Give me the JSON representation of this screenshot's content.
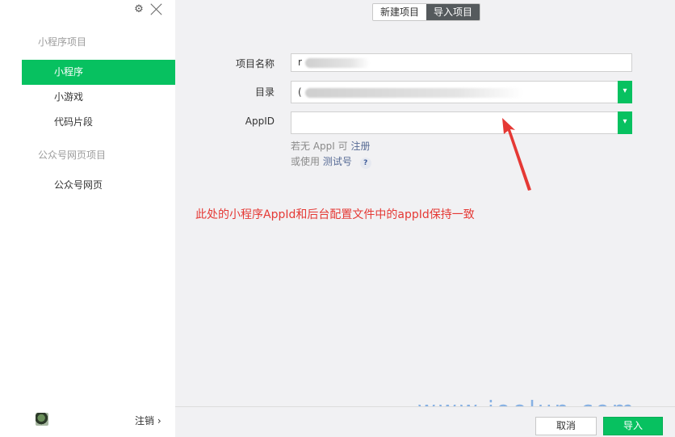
{
  "sidebar": {
    "section_miniprogram": "小程序项目",
    "items_miniprogram": [
      {
        "label": "小程序"
      },
      {
        "label": "小游戏"
      },
      {
        "label": "代码片段"
      }
    ],
    "section_official": "公众号网页项目",
    "items_official": [
      {
        "label": "公众号网页"
      }
    ],
    "logout_label": "注销",
    "logout_chevron": "›"
  },
  "tabs": [
    {
      "label": "新建项目"
    },
    {
      "label": "导入项目"
    }
  ],
  "form": {
    "name_label": "项目名称",
    "name_value": "r",
    "dir_label": "目录",
    "dir_value": "(",
    "appid_label": "AppID",
    "appid_value": "",
    "hint1_prefix": "若无 AppI",
    "hint1_mid": "可",
    "hint1_link": "注册",
    "hint2_prefix": "或使用",
    "hint2_link": "测试号",
    "help_mark": "?"
  },
  "annotation": "此处的小程序AppId和后台配置文件中的appId保持一致",
  "watermark": "www.joolun.com",
  "footer": {
    "cancel_label": "取消",
    "import_label": "导入"
  },
  "colors": {
    "accent": "#07c160",
    "annotation": "#e53935",
    "link": "#576b95"
  }
}
